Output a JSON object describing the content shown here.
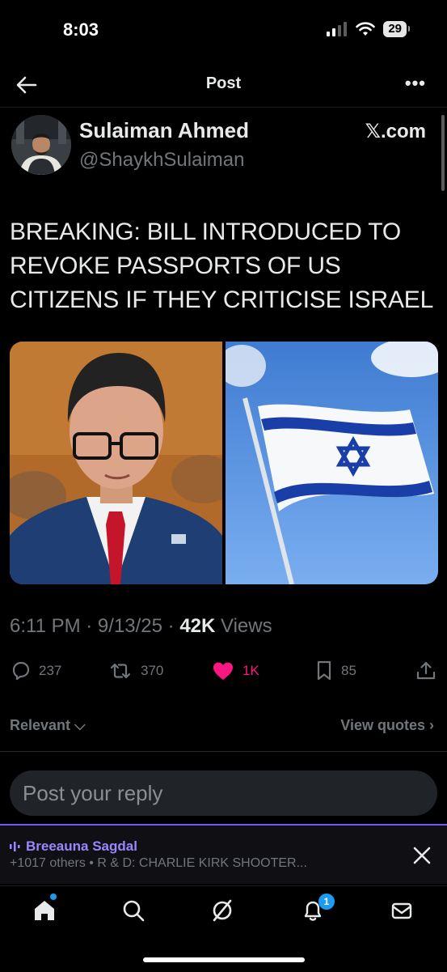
{
  "status_bar": {
    "time": "8:03",
    "battery": "29"
  },
  "header": {
    "title": "Post",
    "more": "•••"
  },
  "post": {
    "author_name": "Sulaiman Ahmed",
    "author_handle": "@ShaykhSulaiman",
    "source": "𝕏.com",
    "text": "BREAKING: BILL INTRODUCED TO REVOKE PASSPORTS OF US CITIZENS IF THEY CRITICISE ISRAEL",
    "time": "6:11 PM · 9/13/25 · ",
    "views_count": "42K",
    "views_label": " Views"
  },
  "actions": {
    "replies": "237",
    "reposts": "370",
    "likes": "1K",
    "bookmarks": "85"
  },
  "sort": {
    "relevant": "Relevant",
    "view_quotes": "View quotes"
  },
  "reply": {
    "placeholder": "Post your reply"
  },
  "space": {
    "host": "Breeauna Sagdal",
    "subtitle": "+1017 others • R & D: CHARLIE KIRK SHOOTER..."
  },
  "tabbar": {
    "notifications_badge": "1"
  },
  "colors": {
    "accent": "#1d9bf0",
    "like": "#f91880",
    "space": "#7856ff"
  }
}
